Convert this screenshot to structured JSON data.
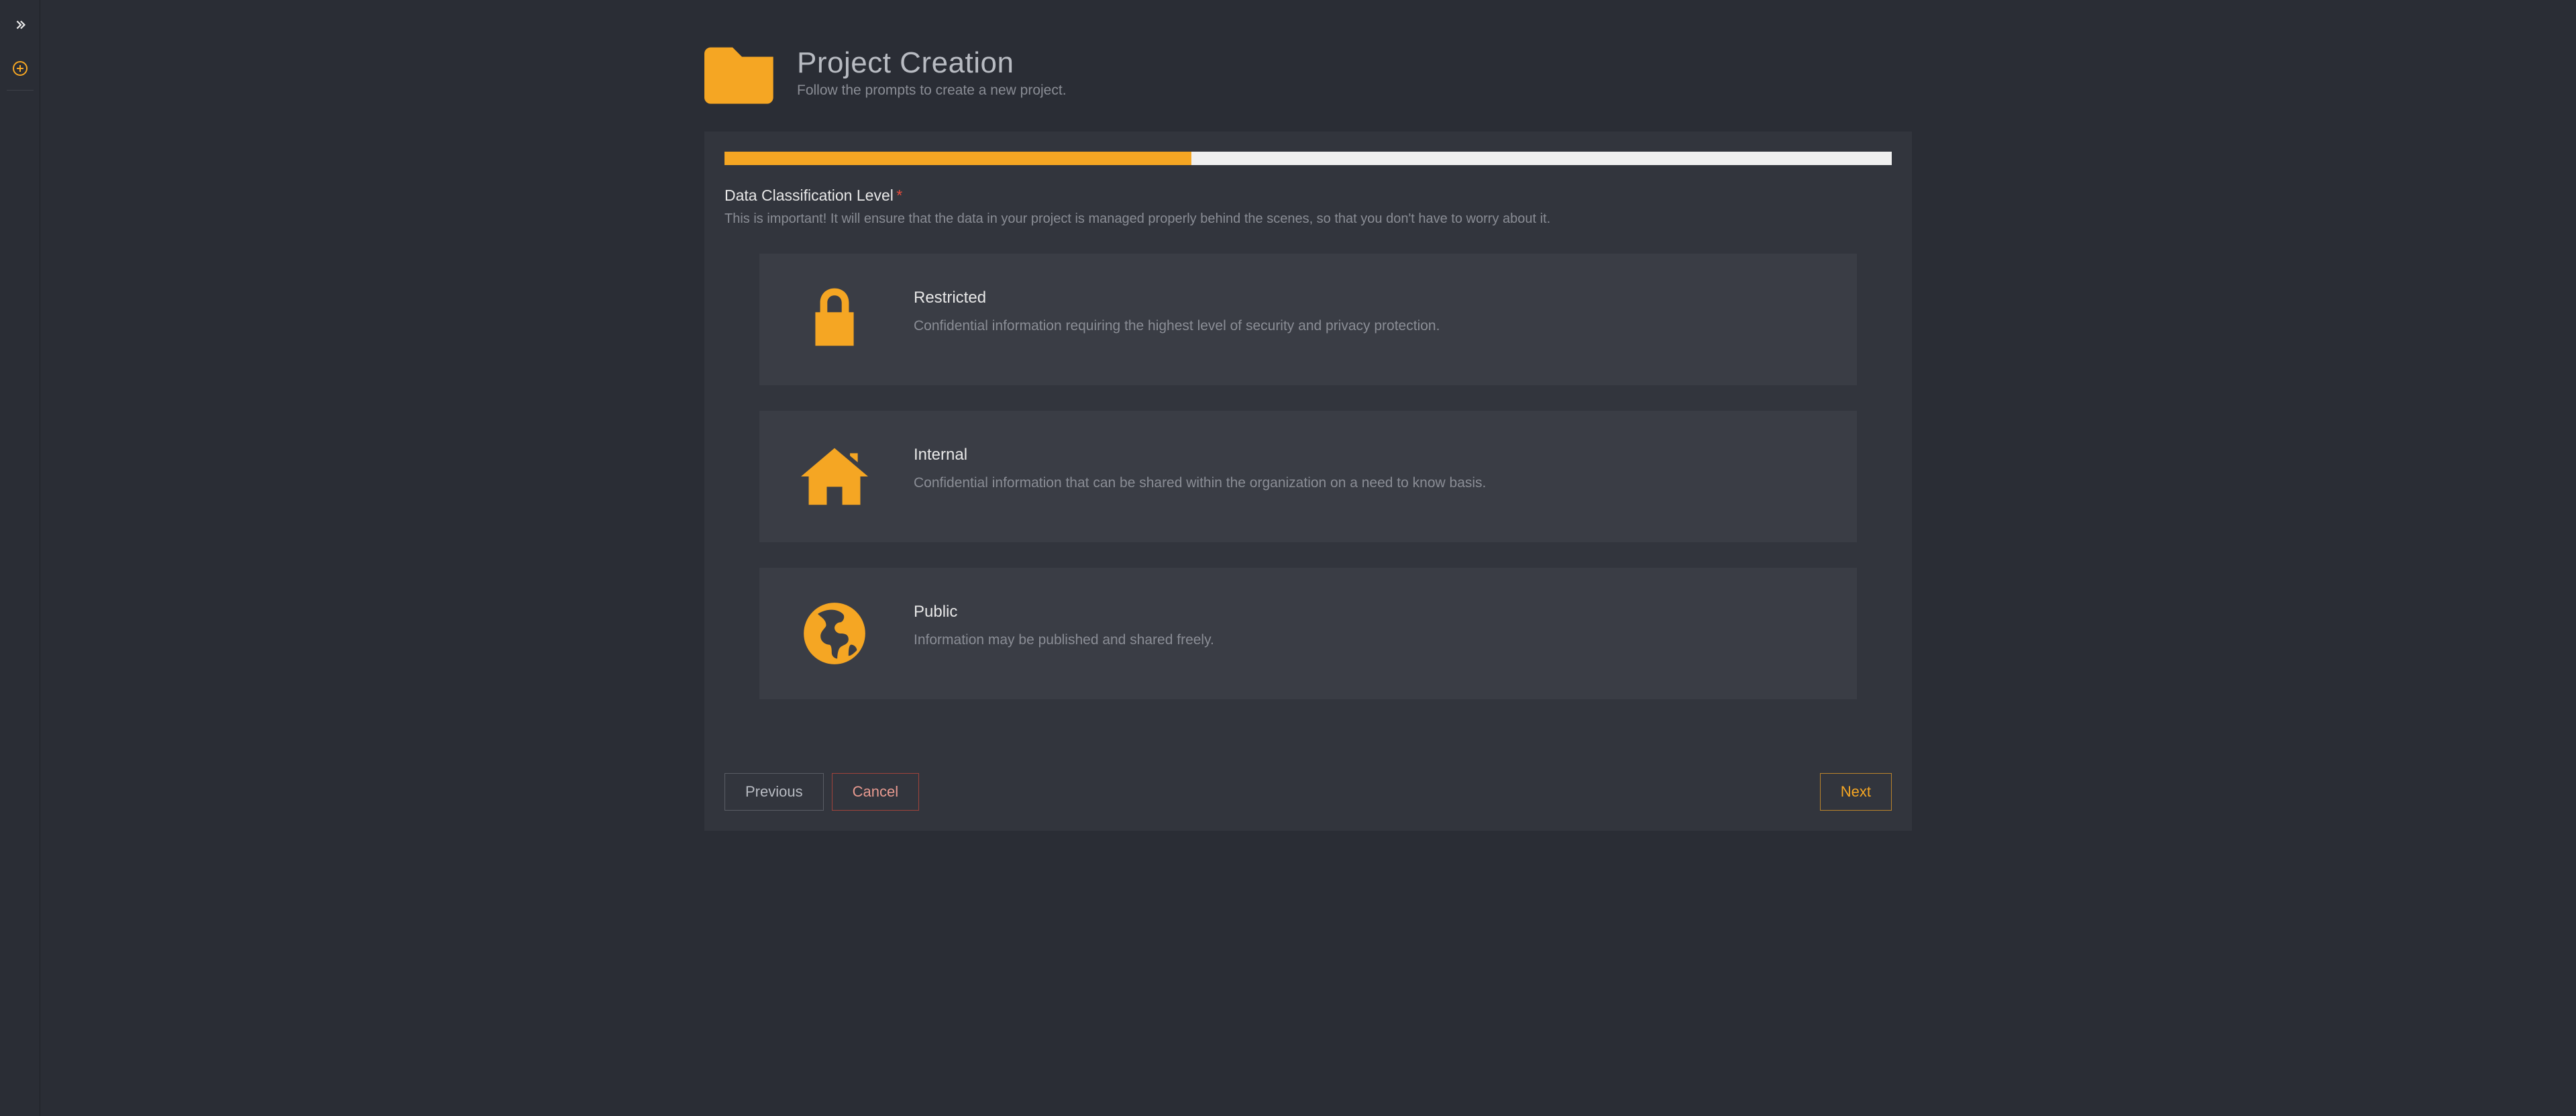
{
  "sidebar": {
    "expand_icon": "expand-right",
    "add_icon": "plus-circle"
  },
  "header": {
    "title": "Project Creation",
    "subtitle": "Follow the prompts to create a new project.",
    "icon": "folder"
  },
  "progress": {
    "percent": 40
  },
  "section": {
    "title": "Data Classification Level",
    "required": true,
    "description": "This is important! It will ensure that the data in your project is managed properly behind the scenes, so that you don't have to worry about it."
  },
  "options": [
    {
      "id": "restricted",
      "icon": "lock",
      "title": "Restricted",
      "description": "Confidential information requiring the highest level of security and privacy protection."
    },
    {
      "id": "internal",
      "icon": "home",
      "title": "Internal",
      "description": "Confidential information that can be shared within the organization on a need to know basis."
    },
    {
      "id": "public",
      "icon": "globe",
      "title": "Public",
      "description": "Information may be published and shared freely."
    }
  ],
  "footer": {
    "previous": "Previous",
    "cancel": "Cancel",
    "next": "Next"
  }
}
